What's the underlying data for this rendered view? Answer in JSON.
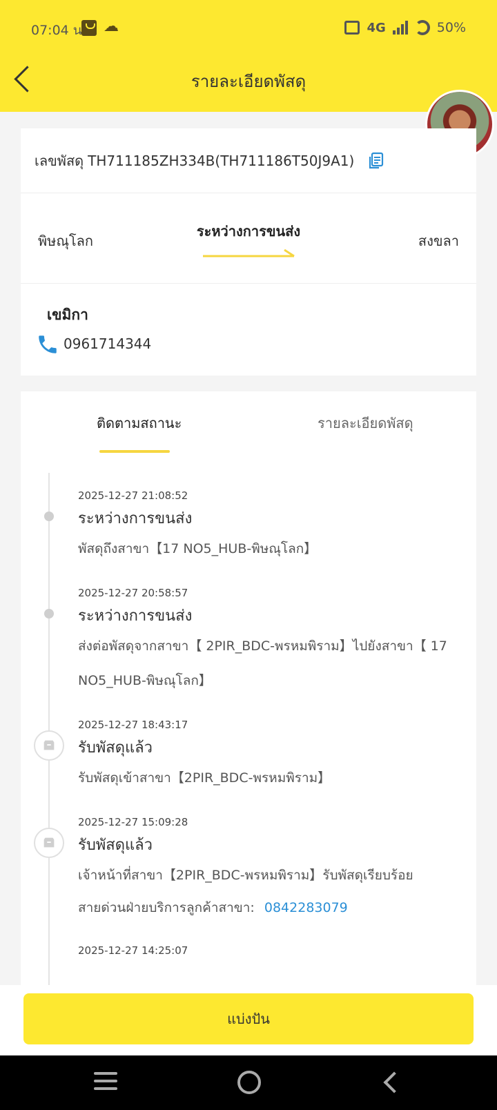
{
  "status_bar": {
    "time": "07:04 น.",
    "network": "4G",
    "battery": "50%"
  },
  "header": {
    "title": "รายละเอียดพัสดุ"
  },
  "parcel": {
    "label": "เลขพัสดุ",
    "number": "TH711185ZH334B(TH711186T50J9A1)"
  },
  "route": {
    "from": "พิษณุโลก",
    "status": "ระหว่างการขนส่ง",
    "to": "สงขลา"
  },
  "receiver": {
    "name": "เขมิกา",
    "phone": "0961714344"
  },
  "tabs": {
    "tracking": "ติดตามสถานะ",
    "details": "รายละเอียดพัสดุ"
  },
  "events": [
    {
      "time": "2025-12-27 21:08:52",
      "title": "ระหว่างการขนส่ง",
      "desc": "พัสดุถึงสาขา【17 NO5_HUB-พิษณุโลก】"
    },
    {
      "time": "2025-12-27 20:58:57",
      "title": "ระหว่างการขนส่ง",
      "desc": "ส่งต่อพัสดุจากสาขา【 2PIR_BDC-พรหมพิราม】ไปยังสาขา【 17 NO5_HUB-พิษณุโลก】"
    },
    {
      "time": "2025-12-27 18:43:17",
      "title": "รับพัสดุแล้ว",
      "desc": "รับพัสดุเข้าสาขา【2PIR_BDC-พรหมพิราม】"
    },
    {
      "time": "2025-12-27 15:09:28",
      "title": "รับพัสดุแล้ว",
      "desc": "เจ้าหน้าที่สาขา【2PIR_BDC-พรหมพิราม】รับพัสดุเรียบร้อย",
      "hotline_label": "สายด่วนฝ่ายบริการลูกค้าสาขา:",
      "hotline_number": "0842283079"
    },
    {
      "time": "2025-12-27 14:25:07"
    }
  ],
  "share_button": "แบ่งปัน",
  "colors": {
    "brand_yellow": "#fde830",
    "link_blue": "#2b8fd6",
    "messenger_blue": "#1e7cf2"
  }
}
